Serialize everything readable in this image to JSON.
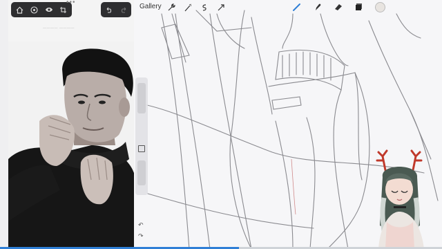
{
  "app": {
    "gallery_label": "Gallery",
    "watermark": "————  ————"
  },
  "reference": {
    "toolbar_icons": [
      "home-icon",
      "target-icon",
      "eye-icon",
      "crop-icon"
    ],
    "toolbar_right_icons": [
      "undo-icon",
      "redo-icon"
    ]
  },
  "canvas_toolbar": {
    "left_icons": [
      "wrench-icon",
      "magic-wand-icon",
      "selection-icon",
      "transform-arrow-icon"
    ],
    "right_icons": [
      "brush-icon",
      "smudge-icon",
      "eraser-icon",
      "layers-icon"
    ],
    "active_tool_color": "#2f7fd6",
    "current_color": "#e8e4e0"
  },
  "sidebar": {
    "undo_symbol": "↶",
    "redo_symbol": "↷"
  },
  "video_progress": 0.54
}
